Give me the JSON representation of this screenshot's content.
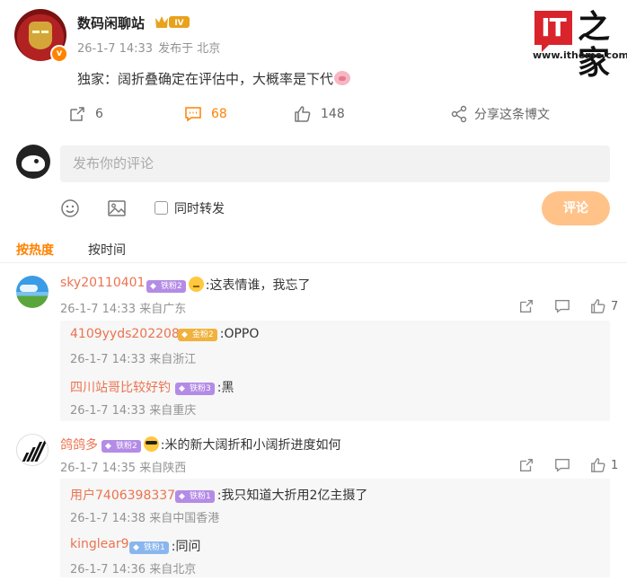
{
  "post": {
    "author": "数码闲聊站",
    "level_badge": "IV",
    "avatar_badge": "v",
    "timestamp": "26-1-7 14:33",
    "location": "发布于 北京",
    "text": "独家：阔折叠确定在评估中，大概率是下代"
  },
  "logo": {
    "mark": "IT",
    "chinese": "之家",
    "url": "www.ithome.com"
  },
  "actions": {
    "repost_count": "6",
    "comment_count": "68",
    "like_count": "148",
    "share_label": "分享这条博文"
  },
  "composer": {
    "placeholder": "发布你的评论",
    "repost_label": "同时转发",
    "submit_label": "评论"
  },
  "sort_tabs": {
    "by_hot": "按热度",
    "by_time": "按时间"
  },
  "comments": [
    {
      "user": "sky20110401",
      "badge": "铁粉2",
      "text": ":这表情谁，我忘了",
      "time": "26-1-7 14:33",
      "location": "来自广东",
      "likes": "7",
      "replies": [
        {
          "user": "4109yyds202208",
          "badge": "金粉2",
          "text": ":OPPO",
          "time": "26-1-7 14:33",
          "location": "来自浙江"
        },
        {
          "user": "四川站哥比较好钓",
          "badge": "铁粉3",
          "text": ":黑",
          "time": "26-1-7 14:33",
          "location": "来自重庆"
        }
      ]
    },
    {
      "user": "鸽鸽多",
      "badge": "铁粉2",
      "text": ":米的新大阔折和小阔折进度如何",
      "time": "26-1-7 14:35",
      "location": "来自陕西",
      "likes": "1",
      "replies": [
        {
          "user": "用户7406398337",
          "badge": "铁粉1",
          "text": ":我只知道大折用2亿主摄了",
          "time": "26-1-7 14:38",
          "location": "来自中国香港"
        },
        {
          "user": "kinglear9",
          "badge": "铁粉1",
          "text": ":同问",
          "time": "26-1-7 14:36",
          "location": "来自北京"
        }
      ]
    }
  ],
  "colors": {
    "accent": "#ff8200",
    "username": "#eb7350",
    "meta": "#939393",
    "submit_disabled": "#ffc38a",
    "logo_red": "#d9242b"
  }
}
